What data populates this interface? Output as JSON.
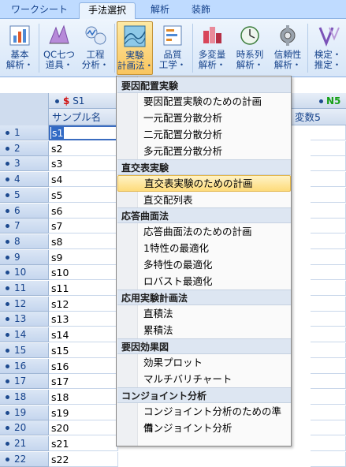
{
  "tabs": [
    {
      "label": "ワークシート",
      "active": false
    },
    {
      "label": "手法選択",
      "active": true
    },
    {
      "label": "解析",
      "active": false
    },
    {
      "label": "装飾",
      "active": false
    }
  ],
  "ribbon": {
    "buttons": [
      {
        "l1": "基本",
        "l2": "解析・",
        "icon": "basic-analysis-icon"
      },
      {
        "l1": "QC七つ",
        "l2": "道具・",
        "icon": "qc-seven-tools-icon"
      },
      {
        "l1": "工程",
        "l2": "分析・",
        "icon": "process-analysis-icon"
      },
      {
        "l1": "実験",
        "l2": "計画法・",
        "icon": "experimental-design-icon",
        "pressed": true
      },
      {
        "l1": "品質",
        "l2": "工学・",
        "icon": "quality-engineering-icon"
      },
      {
        "l1": "多変量",
        "l2": "解析・",
        "icon": "multivariate-analysis-icon"
      },
      {
        "l1": "時系列",
        "l2": "解析・",
        "icon": "time-series-icon"
      },
      {
        "l1": "信頼性",
        "l2": "解析・",
        "icon": "reliability-icon"
      },
      {
        "l1": "検定・",
        "l2": "推定・",
        "icon": "test-estimate-icon"
      }
    ]
  },
  "sheet": {
    "col_a_header": "S1",
    "col_a_name": "サンプル名",
    "col_b_header": "N5",
    "col_b_name": "変数5",
    "rows": [
      {
        "num": "1",
        "value": "s1"
      },
      {
        "num": "2",
        "value": "s2"
      },
      {
        "num": "3",
        "value": "s3"
      },
      {
        "num": "4",
        "value": "s4"
      },
      {
        "num": "5",
        "value": "s5"
      },
      {
        "num": "6",
        "value": "s6"
      },
      {
        "num": "7",
        "value": "s7"
      },
      {
        "num": "8",
        "value": "s8"
      },
      {
        "num": "9",
        "value": "s9"
      },
      {
        "num": "10",
        "value": "s10"
      },
      {
        "num": "11",
        "value": "s11"
      },
      {
        "num": "12",
        "value": "s12"
      },
      {
        "num": "13",
        "value": "s13"
      },
      {
        "num": "14",
        "value": "s14"
      },
      {
        "num": "15",
        "value": "s15"
      },
      {
        "num": "16",
        "value": "s16"
      },
      {
        "num": "17",
        "value": "s17"
      },
      {
        "num": "18",
        "value": "s18"
      },
      {
        "num": "19",
        "value": "s19"
      },
      {
        "num": "20",
        "value": "s20"
      },
      {
        "num": "21",
        "value": "s21"
      },
      {
        "num": "22",
        "value": "s22"
      }
    ]
  },
  "menu": {
    "groups": [
      {
        "title": "要因配置実験",
        "items": [
          "要因配置実験のための計画",
          "一元配置分散分析",
          "二元配置分散分析",
          "多元配置分散分析"
        ]
      },
      {
        "title": "直交表実験",
        "items": [
          "直交表実験のための計画",
          "直交配列表"
        ]
      },
      {
        "title": "応答曲面法",
        "items": [
          "応答曲面法のための計画",
          "1特性の最適化",
          "多特性の最適化",
          "ロバスト最適化"
        ]
      },
      {
        "title": "応用実験計画法",
        "items": [
          "直積法",
          "累積法"
        ]
      },
      {
        "title": "要因効果図",
        "items": [
          "効果プロット",
          "マルチバリチャート"
        ]
      },
      {
        "title": "コンジョイント分析",
        "items": [
          "コンジョイント分析のための準備",
          "コンジョイント分析"
        ]
      }
    ],
    "highlighted": "直交表実験のための計画"
  }
}
